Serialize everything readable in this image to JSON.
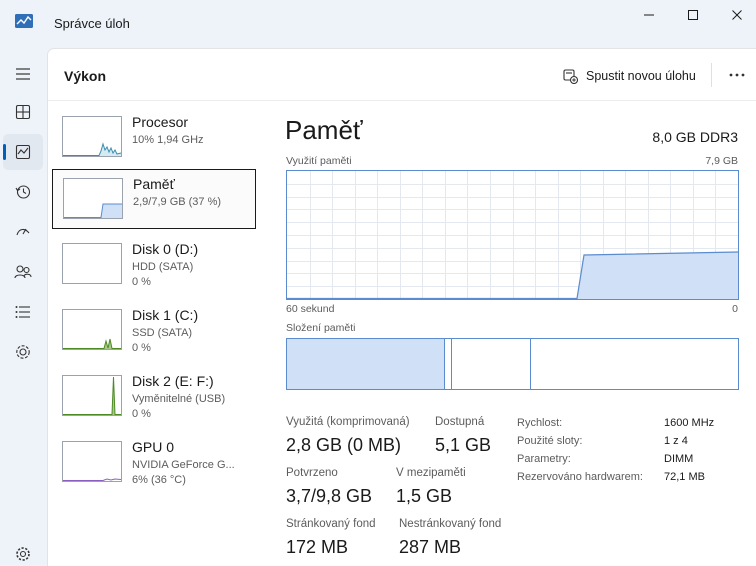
{
  "window": {
    "title": "Správce úloh"
  },
  "header": {
    "page_title": "Výkon",
    "run_new_task": "Spustit novou úlohu"
  },
  "nav": {
    "items": [
      "menu-icon",
      "processes-icon",
      "performance-icon",
      "app-history-icon",
      "startup-icon",
      "users-icon",
      "details-icon",
      "services-icon",
      "settings-icon"
    ]
  },
  "devices": [
    {
      "name": "Procesor",
      "sub1": "10% 1,94 GHz",
      "sub2": "",
      "utilization_percent": 10
    },
    {
      "name": "Paměť",
      "sub1": "2,9/7,9 GB (37 %)",
      "sub2": "",
      "utilization_percent": 37
    },
    {
      "name": "Disk 0 (D:)",
      "sub1": "HDD (SATA)",
      "sub2": "0 %",
      "utilization_percent": 0
    },
    {
      "name": "Disk 1 (C:)",
      "sub1": "SSD (SATA)",
      "sub2": "0 %",
      "utilization_percent": 0
    },
    {
      "name": "Disk 2 (E: F:)",
      "sub1": "Vyměnitelné (USB)",
      "sub2": "0 %",
      "utilization_percent": 0
    },
    {
      "name": "GPU 0",
      "sub1": "NVIDIA GeForce G...",
      "sub2": "6% (36 °C)",
      "utilization_percent": 6
    }
  ],
  "detail": {
    "title": "Paměť",
    "spec": "8,0 GB DDR3",
    "usage_label": "Využití paměti",
    "usage_max": "7,9 GB",
    "time_left": "60 sekund",
    "time_right": "0",
    "composition_label": "Složení paměti",
    "composition_fractions": {
      "in_use": 0.35,
      "modified": 0.015,
      "standby": 0.175,
      "free": 0.46
    },
    "stats": [
      {
        "label": "Využitá (komprimovaná)",
        "value": "2,8 GB (0 MB)"
      },
      {
        "label": "Dostupná",
        "value": "5,1 GB"
      },
      {
        "label": "Potvrzeno",
        "value": "3,7/9,8 GB"
      },
      {
        "label": "V mezipaměti",
        "value": "1,5 GB"
      },
      {
        "label": "Stránkovaný fond",
        "value": "172 MB"
      },
      {
        "label": "Nestránkovaný fond",
        "value": "287 MB"
      }
    ],
    "props": [
      {
        "label": "Rychlost:",
        "value": "1600 MHz"
      },
      {
        "label": "Použité sloty:",
        "value": "1 z 4"
      },
      {
        "label": "Parametry:",
        "value": "DIMM"
      },
      {
        "label": "Rezervováno hardwarem:",
        "value": "72,1 MB"
      }
    ]
  },
  "colors": {
    "accent": "#005fb8",
    "memory_line": "#5b8ccf",
    "memory_fill": "#cfe0f7",
    "cpu_line": "#3a8fb0",
    "disk_line": "#4e8a24"
  }
}
